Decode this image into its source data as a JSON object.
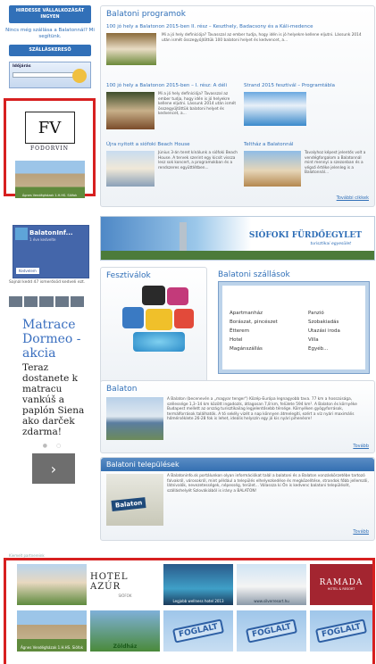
{
  "left": {
    "register_button": "HIRDESSE VÁLLALKOZÁSÁT INGYEN",
    "no_accommodation_text": "Nincs még szállása a Balatonnál? Mi segítünk.",
    "search_accommodation_button": "SZÁLLÁSKERESŐ",
    "weather_label": "Időjárás",
    "fodorvin": {
      "monogram": "FV",
      "name": "FODORVIN",
      "house_caption": "Ágnes Vendégházak 1.H.HS. Siófok"
    },
    "facebook": {
      "name": "BalatonInf...",
      "sub": "1 éve kedvelte",
      "like_label": "Kedvelem",
      "text": "Sajnál kedd 47 ismerősöd kedveli ezt."
    },
    "ad": {
      "headline": "Matrace Dormeo - akcia",
      "body": "Teraz dostanete k matracu vankúš a paplón Siena ako darček zdarma!",
      "dots": "● ○",
      "arrow": "›"
    }
  },
  "programs": {
    "title": "Balatoni programok",
    "articles": [
      {
        "title": "100 jó hely a Balatonon 2015-ben II. rész – Keszthely, Badacsony és a Káli-medence",
        "body": "Mi a jó hely definíciója? Tavasszal az ember tudja, hogy idén is jó helyekre kellene eljutni. Lássunk 2014 után ismét összegyűjtöttük 100 balatoni helyet és kedvencet, a..."
      },
      {
        "title": "100 jó hely a Balatonon 2015-ben – I. rész: A déli",
        "body": "Mi a jó hely definíciója? Tavasszal az ember tudja, hogy idén is jó helyekre kellene eljutni. Lássunk 2014 után ismét összegyűjtöttük balatoni helyet és kedvencet, a..."
      },
      {
        "title": "Strand 2015 fesztivál – Programtábla",
        "body": ""
      },
      {
        "title": "Újra nyitott a siófoki Beach House",
        "body": "Június 3-án teret kínálunk a siófoki Beach House. A tervek szerint egy kicsit vissza lesz sok koncert, a programokban és a rendszeres együttlétben..."
      },
      {
        "title": "Teltház a Balatonnál",
        "body": "Tavalyhoz képest jelentős volt a vendégforgalom a Balatonnál mint mennyi a szezonban és a végső értéke jelenleg is a Balatonnál..."
      }
    ],
    "more": "További cikkek"
  },
  "banner": {
    "brand": "SIÓFOKI FÜRDŐEGYLET",
    "sub": "turisztikai egyesület"
  },
  "festivals": {
    "title": "Fesztiválok"
  },
  "accommodations": {
    "title": "Balatoni szállások",
    "left_items": [
      "Apartmanház",
      "Borászat, pincészet",
      "Étterem",
      "Hotel",
      "Magánszállás"
    ],
    "right_items": [
      "Panzió",
      "Szobakiadás",
      "Utazási iroda",
      "Villa",
      "Egyéb..."
    ]
  },
  "balaton": {
    "title": "Balaton",
    "body": "A Balaton (becenevén a „magyar tenger\") Közép-Európa legnagyobb tava. 77 km a hosszúsága, szélessége 1,3–14 km között ingadozik, átlagosan 7,8 km, felülete 594 km². A Balaton és környéke Budapest mellett az ország turisztikailag legjelentősebb térsége. Környéken gyógyforrások, termálforrások találhatók. A tó sekély vizét a nap könnyen átmelegíti, ezért a víz nyári maximális hőmérséklete 26-28 fok is lehet, ideális helyszín egy jó kis nyári pihenésre!",
    "more": "Tovább"
  },
  "settlements": {
    "title": "Balatoni települések",
    "body": "A Balatoninfo.sk portálunkon olyan információkat talál a balatoni és a Balaton vonzáskörzetébe tartozó falvakról, városokról, mint például a település elhelyezkedése és megközelítése, strandok főbb jellemzői, látnivalók, nevezetességek, népesség, terület... Válassza ki Ön is kedvenc balatoni települését, szálláshelyét Szlovákiából is irány a BALATON!",
    "sign": "Balaton",
    "more": "Tovább"
  },
  "bottom": {
    "note": "Kiemelt partnereink",
    "hotel_azur": {
      "name": "HOTEL AZÚR",
      "sub": "SIÓFOK"
    },
    "wellness_caption": "Legjobb wellness hotel 2013",
    "silver_caption": "www.silverresort.hu",
    "ramada": {
      "name": "RAMADA",
      "sub": "HOTEL & RESORT"
    },
    "house_caption": "Ágnes Vendégházak 1.H.HS. Siófok",
    "zoldhaz": "Zöldház",
    "foglalt": "FOGLALT"
  },
  "colors": {
    "accent": "#3170b8",
    "highlight_border": "#d72020",
    "ramada": "#a32530"
  }
}
